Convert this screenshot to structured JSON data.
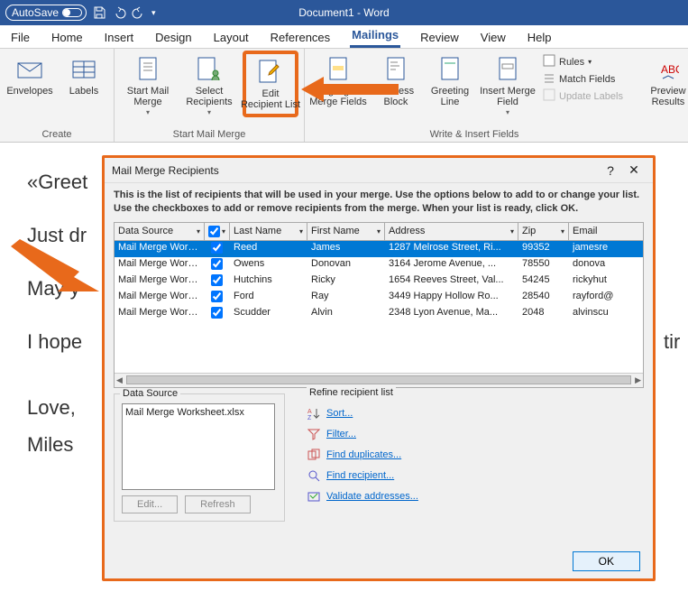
{
  "titlebar": {
    "autosave": "AutoSave",
    "doc_title": "Document1 - Word"
  },
  "menu": {
    "tabs": [
      "File",
      "Home",
      "Insert",
      "Design",
      "Layout",
      "References",
      "Mailings",
      "Review",
      "View",
      "Help"
    ],
    "active": "Mailings"
  },
  "ribbon": {
    "envelopes": "Envelopes",
    "labels": "Labels",
    "start_mail_merge": "Start Mail\nMerge",
    "select_recipients": "Select\nRecipients",
    "edit_recipient_list": "Edit\nRecipient List",
    "highlight_merge_fields": "Highlight\nMerge Fields",
    "address_block": "Address\nBlock",
    "greeting_line": "Greeting\nLine",
    "insert_merge_field": "Insert Merge\nField",
    "rules": "Rules",
    "match_fields": "Match Fields",
    "update_labels": "Update Labels",
    "preview_results": "Preview\nResults",
    "group_create": "Create",
    "group_start": "Start Mail Merge",
    "group_write": "Write & Insert Fields"
  },
  "document": {
    "p1": "«Greet",
    "p2": "Just dr",
    "p3": "May y",
    "p4": "I hope",
    "p4_right": "tir",
    "p5": "Love,",
    "p6": "Miles "
  },
  "dialog": {
    "title": "Mail Merge Recipients",
    "help": "?",
    "desc1": "This is the list of recipients that will be used in your merge.  Use the options below to add to or change your list.",
    "desc2": "Use the checkboxes to add or remove recipients from the merge.  When your list is ready, click OK.",
    "cols": {
      "ds": "Data Source",
      "ln": "Last Name",
      "fn": "First Name",
      "ad": "Address",
      "zp": "Zip",
      "em": "Email"
    },
    "rows": [
      {
        "sel": true,
        "ds": "Mail Merge Work...",
        "chk": true,
        "ln": "Reed",
        "fn": "James",
        "ad": "1287  Melrose Street, Ri...",
        "zp": "99352",
        "em": "jamesre"
      },
      {
        "sel": false,
        "ds": "Mail Merge Work...",
        "chk": true,
        "ln": "Owens",
        "fn": "Donovan",
        "ad": "3164  Jerome Avenue, ...",
        "zp": "78550",
        "em": "donova"
      },
      {
        "sel": false,
        "ds": "Mail Merge Work...",
        "chk": true,
        "ln": "Hutchins",
        "fn": "Ricky",
        "ad": "1654  Reeves Street, Val...",
        "zp": "54245",
        "em": "rickyhut"
      },
      {
        "sel": false,
        "ds": "Mail Merge Work...",
        "chk": true,
        "ln": "Ford",
        "fn": "Ray",
        "ad": "3449  Happy Hollow Ro...",
        "zp": "28540",
        "em": "rayford@"
      },
      {
        "sel": false,
        "ds": "Mail Merge Work...",
        "chk": true,
        "ln": "Scudder",
        "fn": "Alvin",
        "ad": "2348  Lyon Avenue, Ma...",
        "zp": "2048",
        "em": "alvinscu"
      }
    ],
    "data_source_label": "Data Source",
    "data_source_file": "Mail Merge Worksheet.xlsx",
    "edit_btn": "Edit...",
    "refresh_btn": "Refresh",
    "refine_label": "Refine recipient list",
    "refine": {
      "sort": "Sort...",
      "filter": "Filter...",
      "dup": "Find duplicates...",
      "find": "Find recipient...",
      "validate": "Validate addresses..."
    },
    "ok": "OK"
  }
}
